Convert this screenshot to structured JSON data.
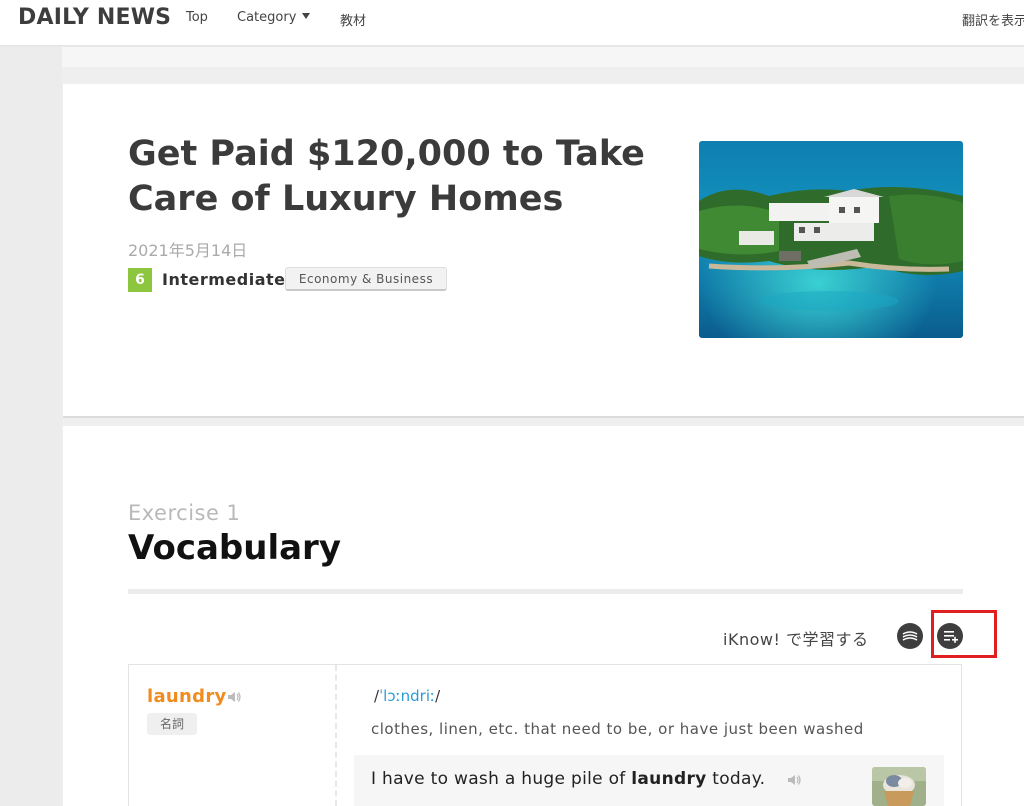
{
  "nav": {
    "brand": "DAILY NEWS",
    "items": [
      "Top",
      "Category",
      "教材"
    ],
    "translate": "翻訳を表示"
  },
  "article": {
    "title": "Get Paid $120,000 to Take Care of Luxury Homes",
    "date": "2021年5月14日",
    "level_number": "6",
    "level_name": "Intermediate",
    "category": "Economy & Business"
  },
  "exercise": {
    "label": "Exercise 1",
    "title": "Vocabulary",
    "iknow_text": "iKnow! で学習する"
  },
  "vocab": {
    "word": "laundry",
    "pos": "名詞",
    "ipa_prefix": "/",
    "ipa_body": "ˈlɔːndriː",
    "ipa_suffix": "/",
    "definition": "clothes, linen, etc. that need to be, or have just been washed",
    "example_before": "I have to wash a huge pile of ",
    "example_word": "laundry",
    "example_after": " today."
  },
  "icons": {
    "caret": "chevron-down-icon",
    "speaker": "speaker-icon",
    "iknow": "iknow-icon",
    "add": "playlist-add-icon"
  },
  "colors": {
    "level_badge": "#8cc63f",
    "word": "#f08c1e",
    "ipa": "#2b9bd6",
    "highlight": "#e02020"
  }
}
